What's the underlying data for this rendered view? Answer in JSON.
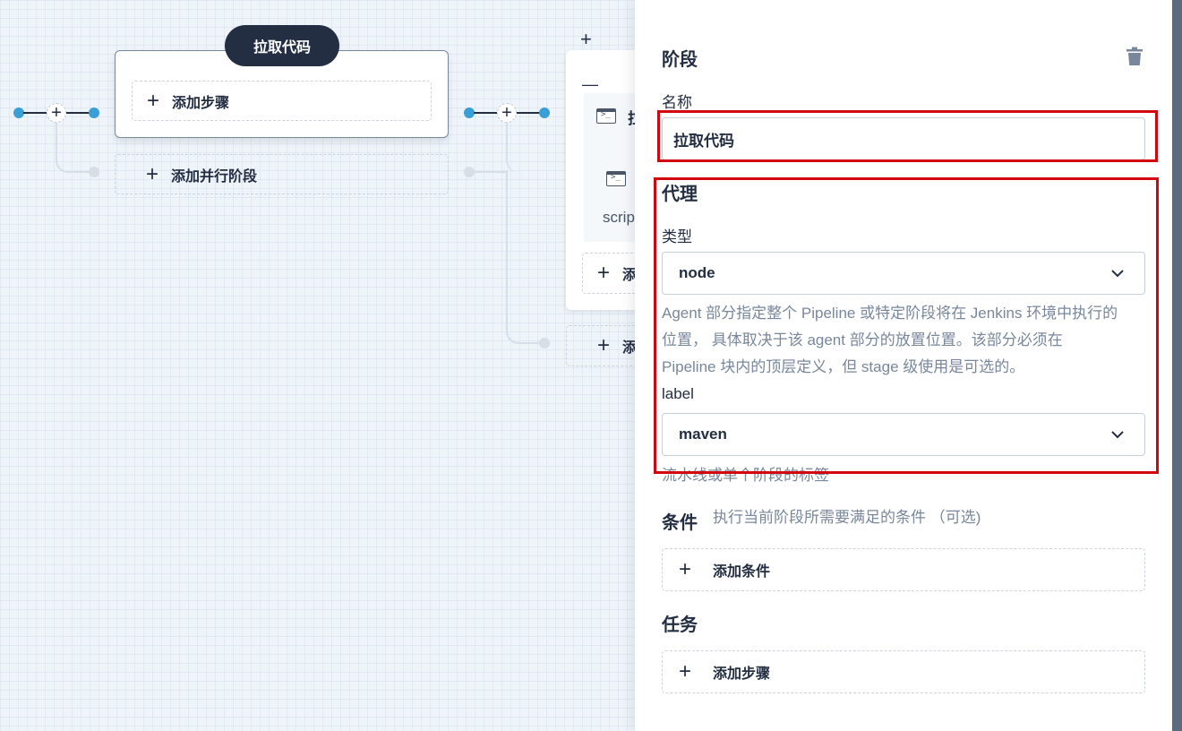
{
  "canvas": {
    "stage1": {
      "title": "拉取代码",
      "add_step_label": "添加步骤",
      "add_parallel_label": "添加并行阶段"
    },
    "stage2": {
      "add_icon_glyph": "+",
      "collapse_icon_glyph": "—",
      "step1_label": "拉",
      "step2_label": "scrip",
      "add_step_label": "添",
      "add_parallel_label": "添"
    },
    "plus_glyph": "+"
  },
  "panel": {
    "title": "阶段",
    "name_label": "名称",
    "name_value": "拉取代码",
    "agent_heading": "代理",
    "type_label": "类型",
    "type_value": "node",
    "agent_description": "Agent 部分指定整个 Pipeline 或特定阶段将在 Jenkins 环境中执行的位置， 具体取决于该 agent 部分的放置位置。该部分必须在 Pipeline 块内的顶层定义，但 stage 级使用是可选的。",
    "agent_description_lines": [
      "Agent 部分指定整个 Pipeline 或特定阶段将在 Jenkins 环境中执行的",
      "位置， 具体取决于该 agent 部分的放置位置。该部分必须在",
      "Pipeline 块内的顶层定义，但 stage 级使用是可选的。"
    ],
    "label_label": "label",
    "label_value": "maven",
    "label_description": "流水线或单个阶段的标签",
    "condition_heading": "条件",
    "condition_hint": "执行当前阶段所需要满足的条件 （可选)",
    "add_condition_label": "添加条件",
    "task_heading": "任务",
    "add_step_label": "添加步骤"
  },
  "colors": {
    "accent_dot": "#3a9fd6",
    "dark": "#242e42",
    "highlight": "#d3050f",
    "muted_text": "#79879c"
  }
}
